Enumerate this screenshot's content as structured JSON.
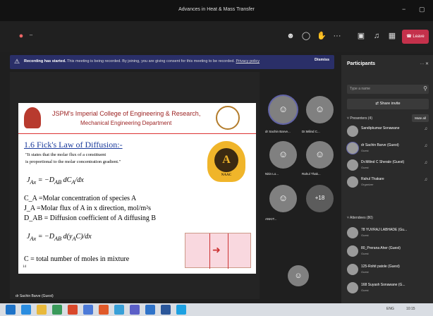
{
  "window": {
    "title": "Advances in Heat & Mass Transfer",
    "minimize": "−",
    "maximize": "▢",
    "close": "✕"
  },
  "toolbar": {
    "timer": "--",
    "leave_label": "Leave",
    "more": "···"
  },
  "banner": {
    "bold": "Recording has started.",
    "text": "This meeting is being recorded. By joining, you are giving consent for this meeting to be recorded.",
    "link": "Privacy policy",
    "dismiss": "Dismiss"
  },
  "slide": {
    "college_line1": "JSPM's Imperial College of Engineering & Research,",
    "college_line2": "Mechanical Engineering Department",
    "heading": "1.6 Fick's Law of Diffusion:-",
    "quote1": "\"It states that the molar flux of a constituent",
    "quote2": "is proportional to the molar concentration gradient.\"",
    "ca_def": "C_A =Molar concentration of species A",
    "ja_def": "J_A =Molar flux of A in x direction, mol/m²s",
    "dab_def": "D_AB = Diffusion coefficient of A diffusing B",
    "c_def": "C = total number of moles in mixture",
    "page": "14",
    "naac": "NAAC"
  },
  "presenter_label": "dr Sachin Barve (Guest)",
  "tiles": [
    {
      "label": "dr Sachin Barve..."
    },
    {
      "label": "Dr.Milind C..."
    },
    {
      "label": "Nitin Lo..."
    },
    {
      "label": "Rahul Thak..."
    },
    {
      "label": "ANKIT..."
    },
    {
      "label": "+18"
    }
  ],
  "panel": {
    "title": "Participants",
    "search_placeholder": "Type a name",
    "share_invite": "Share invite",
    "presenters_header": "Presenters (4)",
    "mute_all": "Mute all",
    "presenters": [
      {
        "name": "Sandipkumar Sonawane",
        "role": ""
      },
      {
        "name": "dr Sachin Barve (Guest)",
        "role": "Guest"
      },
      {
        "name": "Dr.Milind C Sherale (Guest)",
        "role": "Guest"
      },
      {
        "name": "Rahul Thakare",
        "role": "Organizer"
      }
    ],
    "attendees_header": "Attendees (80)",
    "attendees": [
      {
        "name": "78 YUVRAJ LABHADE (Gu...",
        "role": "Guest"
      },
      {
        "name": "80_Prerana Aher (Guest)",
        "role": "Guest"
      },
      {
        "name": "125-Rohit patole (Guest)",
        "role": "Guest"
      },
      {
        "name": "168 Suyash Sonawane (G...",
        "role": "Guest"
      }
    ]
  },
  "taskbar": {
    "lang": "ENG",
    "time": "10:15"
  },
  "colors": {
    "leave": "#c4314b",
    "banner": "#2a2f68",
    "panel": "#2b2b2b",
    "accent": "#6264a7"
  }
}
